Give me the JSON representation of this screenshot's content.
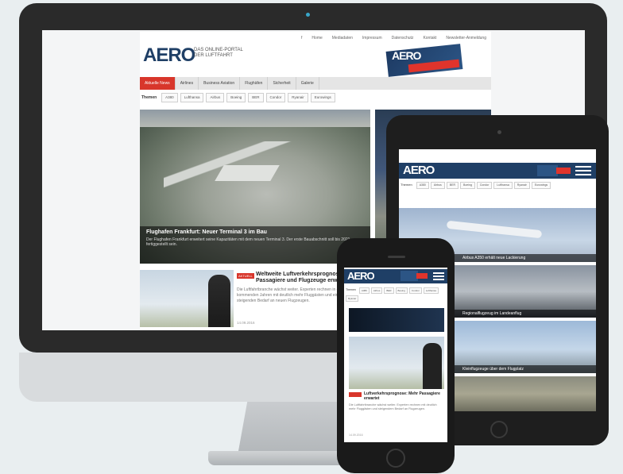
{
  "desktop": {
    "top_links": [
      "Home",
      "Mediadaten",
      "Impressum",
      "Datenschutz",
      "Kontakt",
      "Newsletter-Anmeldung"
    ],
    "logo": "AERO",
    "tagline": [
      "DAS ONLINE-PORTAL",
      "DER LUFTFAHRT"
    ],
    "ad_logo": "AERO",
    "menu": [
      "Aktuelle News",
      "Airlines",
      "Business Aviation",
      "Flughäfen",
      "Sicherheit",
      "Galerie"
    ],
    "tags_label": "Themen",
    "tags": [
      "A380",
      "Lufthansa",
      "Airbus",
      "Boeing",
      "BER",
      "Condor",
      "Ryanair",
      "Eurowings"
    ],
    "hero_title": "Flughafen Frankfurt: Neuer Terminal 3 im Bau",
    "hero_text": "Der Flughafen Frankfurt erweitert seine Kapazitäten mit dem neuen Terminal 3. Der erste Bauabschnitt soll bis 2021 fertiggestellt sein.",
    "article_badge": "AKTUELL",
    "article_title": "Weltweite Luftverkehrsprognose: Mehr Passagiere und Flugzeuge erwartet",
    "article_text": "Die Luftfahrtbranche wächst weiter. Experten rechnen in den kommenden Jahren mit deutlich mehr Fluggästen und einem steigenden Bedarf an neuen Flugzeugen.",
    "article_meta": "14.09.2016"
  },
  "tablet": {
    "logo": "AERO",
    "tags_label": "Themen",
    "tags": [
      "A380",
      "Airbus",
      "BER",
      "Boeing",
      "Condor",
      "Lufthansa",
      "Ryanair",
      "Eurowings"
    ],
    "captions": [
      "Airbus A350 erhält neue Lackierung",
      "Regionalflugzeug im Landeanflug",
      "Kleinflugzeuge über dem Flugplatz",
      ""
    ]
  },
  "phone": {
    "logo": "AERO",
    "tags_label": "Themen",
    "tags": [
      "A380",
      "Airbus",
      "BER",
      "Boeing",
      "Condor",
      "Lufthansa",
      "Ryanair"
    ],
    "article_title": "Luftverkehrsprognose: Mehr Passagiere erwartet",
    "article_text": "Die Luftfahrtbranche wächst weiter. Experten rechnen mit deutlich mehr Fluggästen und steigendem Bedarf an Flugzeugen.",
    "article_meta": "14.09.2016"
  },
  "colors": {
    "brand": "#1f3f66",
    "accent": "#d8362b",
    "device": "#1e1e1e"
  }
}
